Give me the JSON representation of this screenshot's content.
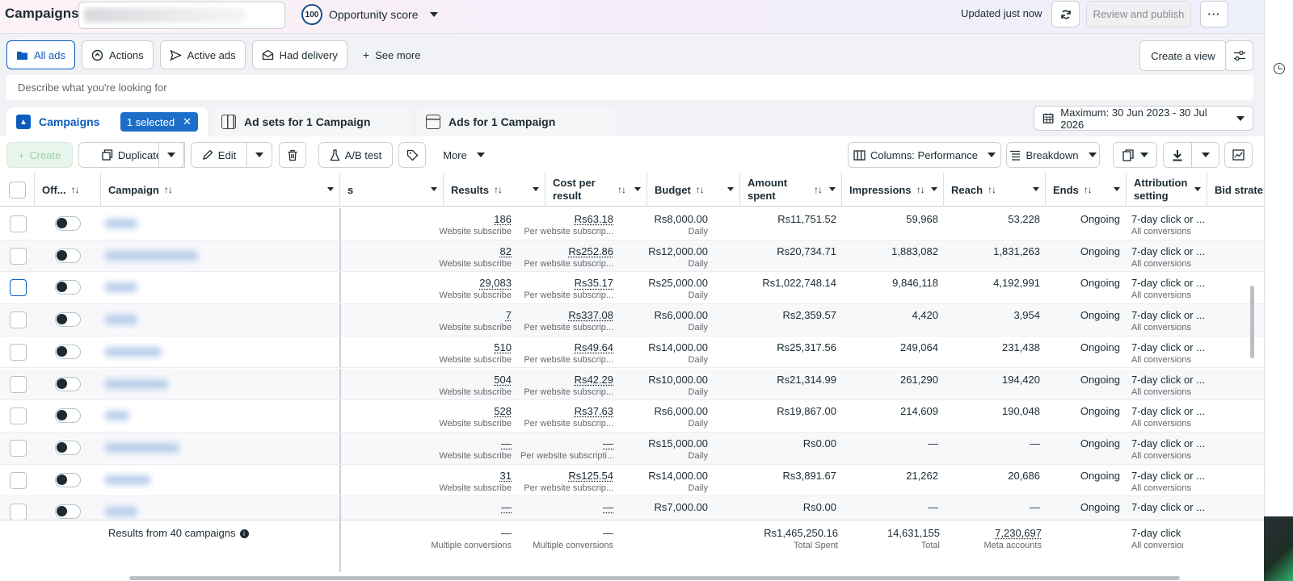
{
  "header": {
    "title": "Campaigns",
    "opportunity_score_value": "100",
    "opportunity_score_label": "Opportunity score",
    "updated": "Updated just now",
    "review_publish": "Review and publish",
    "more": "···"
  },
  "filters": {
    "chips": [
      {
        "label": "All ads",
        "icon": "folder-icon"
      },
      {
        "label": "Actions",
        "icon": "actions-icon"
      },
      {
        "label": "Active ads",
        "icon": "send-icon"
      },
      {
        "label": "Had delivery",
        "icon": "envelope-icon"
      },
      {
        "label": "See more",
        "icon": "plus-icon"
      }
    ],
    "create_view": "Create a view"
  },
  "search": {
    "placeholder": "Describe what you're looking for"
  },
  "tabs": {
    "campaigns": "Campaigns",
    "selected": "1 selected",
    "adsets": "Ad sets for 1 Campaign",
    "ads": "Ads for 1 Campaign"
  },
  "date_range": "Maximum: 30 Jun 2023 - 30 Jul 2026",
  "toolbar": {
    "create": "Create",
    "duplicate": "Duplicate",
    "edit": "Edit",
    "ab_test": "A/B test",
    "more": "More",
    "columns": "Columns: Performance",
    "breakdown": "Breakdown"
  },
  "table": {
    "headers": {
      "off": "Off...",
      "campaign": "Campaign",
      "partial": "s",
      "results": "Results",
      "cost_per_result": "Cost per result",
      "budget": "Budget",
      "amount_spent": "Amount spent",
      "impressions": "Impressions",
      "reach": "Reach",
      "ends": "Ends",
      "attribution": "Attribution setting",
      "bid_strategy": "Bid strate"
    },
    "rows": [
      {
        "results": "186",
        "results_sub": "Website subscribe",
        "cpr": "Rs63.18",
        "cpr_sub": "Per website subscrip...",
        "budget": "Rs8,000.00",
        "budget_sub": "Daily",
        "spent": "Rs11,751.52",
        "impressions": "59,968",
        "reach": "53,228",
        "ends": "Ongoing",
        "attribution": "7-day click or ...",
        "attribution_sub": "All conversions"
      },
      {
        "results": "82",
        "results_sub": "Website subscribe",
        "cpr": "Rs252.86",
        "cpr_sub": "Per website subscrip...",
        "budget": "Rs12,000.00",
        "budget_sub": "Daily",
        "spent": "Rs20,734.71",
        "impressions": "1,883,082",
        "reach": "1,831,263",
        "ends": "Ongoing",
        "attribution": "7-day click or ...",
        "attribution_sub": "All conversions"
      },
      {
        "results": "29,083",
        "results_sub": "Website subscribe",
        "cpr": "Rs35.17",
        "cpr_sub": "Per website subscrip...",
        "budget": "Rs25,000.00",
        "budget_sub": "Daily",
        "spent": "Rs1,022,748.14",
        "impressions": "9,846,118",
        "reach": "4,192,991",
        "ends": "Ongoing",
        "attribution": "7-day click or ...",
        "attribution_sub": "All conversions"
      },
      {
        "results": "7",
        "results_sub": "Website subscribe",
        "cpr": "Rs337.08",
        "cpr_sub": "Per website subscrip...",
        "budget": "Rs6,000.00",
        "budget_sub": "Daily",
        "spent": "Rs2,359.57",
        "impressions": "4,420",
        "reach": "3,954",
        "ends": "Ongoing",
        "attribution": "7-day click or ...",
        "attribution_sub": "All conversions"
      },
      {
        "results": "510",
        "results_sub": "Website subscribe",
        "cpr": "Rs49.64",
        "cpr_sub": "Per website subscrip...",
        "budget": "Rs14,000.00",
        "budget_sub": "Daily",
        "spent": "Rs25,317.56",
        "impressions": "249,064",
        "reach": "231,438",
        "ends": "Ongoing",
        "attribution": "7-day click or ...",
        "attribution_sub": "All conversions"
      },
      {
        "results": "504",
        "results_sub": "Website subscribe",
        "cpr": "Rs42.29",
        "cpr_sub": "Per website subscrip...",
        "budget": "Rs10,000.00",
        "budget_sub": "Daily",
        "spent": "Rs21,314.99",
        "impressions": "261,290",
        "reach": "194,420",
        "ends": "Ongoing",
        "attribution": "7-day click or ...",
        "attribution_sub": "All conversions"
      },
      {
        "results": "528",
        "results_sub": "Website subscribe",
        "cpr": "Rs37.63",
        "cpr_sub": "Per website subscrip...",
        "budget": "Rs6,000.00",
        "budget_sub": "Daily",
        "spent": "Rs19,867.00",
        "impressions": "214,609",
        "reach": "190,048",
        "ends": "Ongoing",
        "attribution": "7-day click or ...",
        "attribution_sub": "All conversions"
      },
      {
        "results": "—",
        "results_sub": "Website subscribe",
        "cpr": "—",
        "cpr_sub": "Per website subscripti...",
        "budget": "Rs15,000.00",
        "budget_sub": "Daily",
        "spent": "Rs0.00",
        "impressions": "—",
        "reach": "—",
        "ends": "Ongoing",
        "attribution": "7-day click or ...",
        "attribution_sub": "All conversions"
      },
      {
        "results": "31",
        "results_sub": "Website subscribe",
        "cpr": "Rs125.54",
        "cpr_sub": "Per website subscrip...",
        "budget": "Rs14,000.00",
        "budget_sub": "Daily",
        "spent": "Rs3,891.67",
        "impressions": "21,262",
        "reach": "20,686",
        "ends": "Ongoing",
        "attribution": "7-day click or ...",
        "attribution_sub": "All conversions"
      },
      {
        "results": "—",
        "results_sub": "",
        "cpr": "—",
        "cpr_sub": "",
        "budget": "Rs7,000.00",
        "budget_sub": "",
        "spent": "Rs0.00",
        "impressions": "—",
        "reach": "—",
        "ends": "Ongoing",
        "attribution": "7-day click or ...",
        "attribution_sub": ""
      }
    ],
    "summary": {
      "label": "Results from 40 campaigns",
      "results": "—",
      "results_sub": "Multiple conversions",
      "cpr": "—",
      "cpr_sub": "Multiple conversions",
      "spent": "Rs1,465,250.16",
      "spent_sub": "Total Spent",
      "impressions": "14,631,155",
      "impressions_sub": "Total",
      "reach": "7,230,697",
      "reach_sub": "Meta accounts",
      "attribution": "7-day click",
      "attribution_sub": "All conversion"
    }
  }
}
